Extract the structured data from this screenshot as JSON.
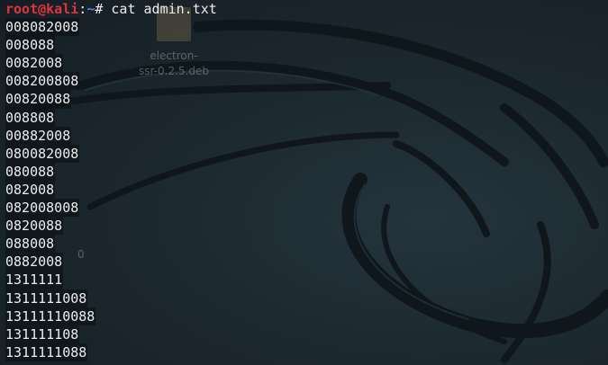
{
  "desktop": {
    "icon_name": "package-file-icon",
    "file_label_line1": "electron-",
    "file_label_line2": "ssr-0.2.5.deb",
    "ghost_text": "0"
  },
  "terminal": {
    "prompt": {
      "user_host": "root@kali",
      "separator": ":",
      "path": "~",
      "symbol": "# "
    },
    "command": "cat admin.txt",
    "output": [
      "008082008",
      "008088",
      "0082008",
      "008200808",
      "00820088",
      "008808",
      "00882008",
      "080082008",
      "080088",
      "082008",
      "082008008",
      "0820088",
      "088008",
      "0882008",
      "1311111",
      "1311111008",
      "13111110088",
      "131111108",
      "1311111088"
    ]
  },
  "colors": {
    "prompt_user": "#e0343c",
    "prompt_path": "#4f8ad6",
    "text": "#ececec",
    "background": "#1e2a32"
  }
}
